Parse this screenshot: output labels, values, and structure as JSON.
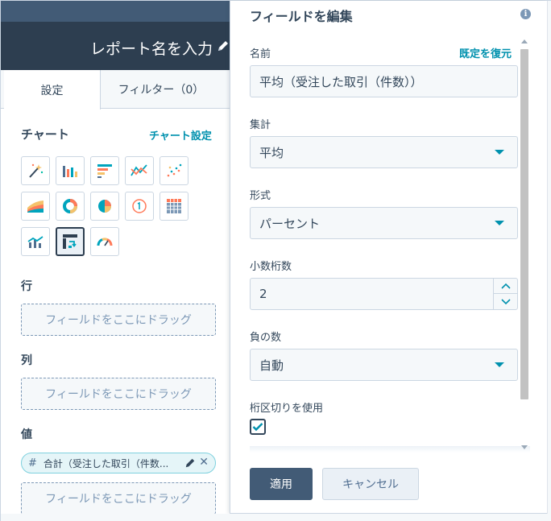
{
  "report": {
    "name": "レポート名を入力"
  },
  "tabs": [
    {
      "label": "設定"
    },
    {
      "label": "フィルター（0）"
    }
  ],
  "chart_section": {
    "title": "チャート",
    "settings_link": "チャート設定"
  },
  "chart_types": [
    {
      "icon": "magic-wand-icon"
    },
    {
      "icon": "column-chart-icon"
    },
    {
      "icon": "bar-chart-icon"
    },
    {
      "icon": "line-chart-icon"
    },
    {
      "icon": "scatter-chart-icon"
    },
    {
      "icon": "area-chart-icon"
    },
    {
      "icon": "donut-chart-icon"
    },
    {
      "icon": "pie-chart-icon"
    },
    {
      "icon": "single-value-icon"
    },
    {
      "icon": "table-icon"
    },
    {
      "icon": "combo-chart-icon"
    },
    {
      "icon": "pivot-table-icon",
      "active": true
    },
    {
      "icon": "gauge-icon"
    }
  ],
  "rows_section": {
    "label": "行",
    "drop_text": "フィールドをここにドラッグ"
  },
  "columns_section": {
    "label": "列",
    "drop_text": "フィールドをここにドラッグ"
  },
  "values_section": {
    "label": "値",
    "chip": {
      "hash": "#",
      "text": "合計（受注した取引（件数..."
    },
    "drop_text": "フィールドをここにドラッグ"
  },
  "edit_panel": {
    "title": "フィールドを編集",
    "name_label": "名前",
    "restore_default": "既定を復元",
    "name_value": "平均（受注した取引（件数））",
    "aggregation_label": "集計",
    "aggregation_value": "平均",
    "format_label": "形式",
    "format_value": "パーセント",
    "decimals_label": "小数桁数",
    "decimals_value": "2",
    "negative_label": "負の数",
    "negative_value": "自動",
    "separator_label": "桁区切りを使用",
    "separator_checked": true,
    "apply_label": "適用",
    "cancel_label": "キャンセル"
  },
  "colors": {
    "header": "#2d3e50",
    "accent": "#0091ae",
    "primary_button": "#425b76",
    "text": "#33475b"
  }
}
